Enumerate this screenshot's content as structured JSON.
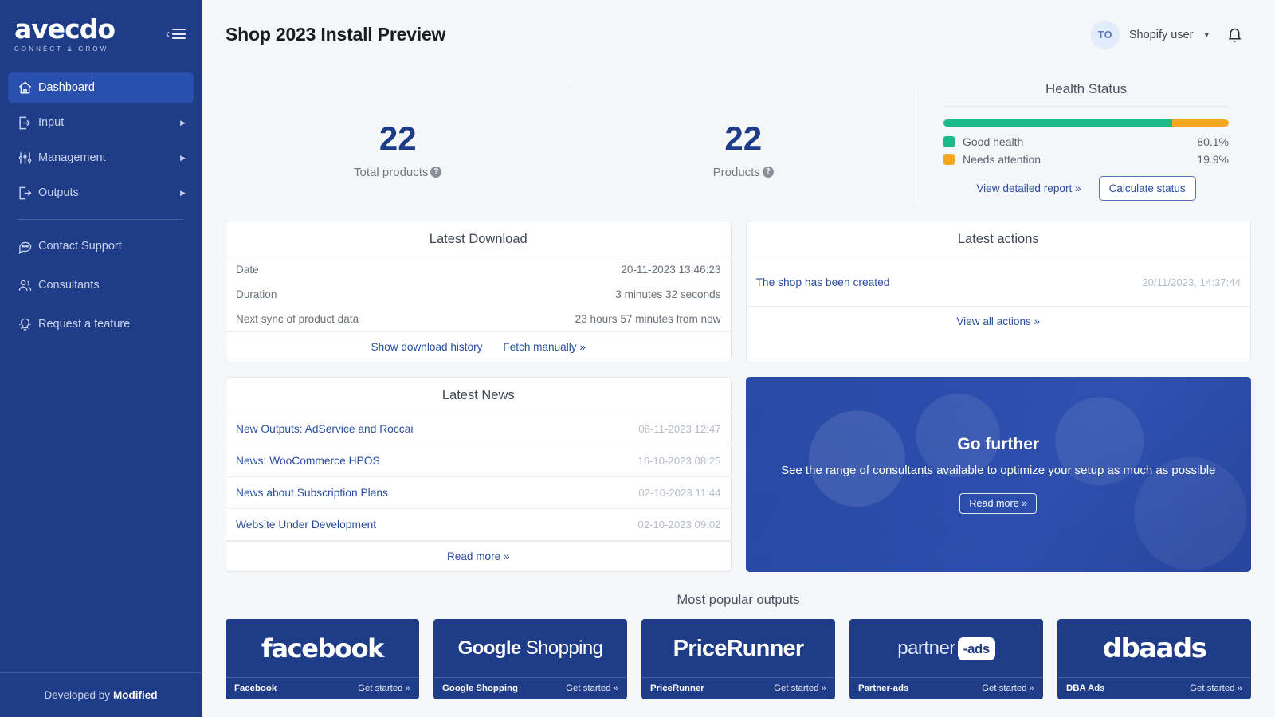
{
  "sidebar": {
    "logo_text": "avecdo",
    "logo_tagline": "CONNECT & GROW",
    "collapse_icon": "collapse-menu-icon",
    "nav": [
      {
        "label": "Dashboard",
        "icon": "home-icon",
        "active": true,
        "arrow": ""
      },
      {
        "label": "Input",
        "icon": "import-icon",
        "active": false,
        "arrow": "▶"
      },
      {
        "label": "Management",
        "icon": "sliders-icon",
        "active": false,
        "arrow": "▶"
      },
      {
        "label": "Outputs",
        "icon": "export-icon",
        "active": false,
        "arrow": "▶"
      }
    ],
    "secondary": [
      {
        "label": "Contact Support",
        "icon": "chat-bubble-icon"
      },
      {
        "label": "Consultants",
        "icon": "users-icon"
      },
      {
        "label": "Request a feature",
        "icon": "lightbulb-icon"
      }
    ],
    "footer_prefix": "Developed by",
    "footer_brand": "Modified"
  },
  "header": {
    "title": "Shop 2023 Install Preview",
    "avatar_initials": "TO",
    "user_name": "Shopify user",
    "caret_icon": "chevron-down-icon",
    "bell_icon": "notification-bell-icon"
  },
  "stats": [
    {
      "value": "22",
      "label": "Total products",
      "help": "?"
    },
    {
      "value": "22",
      "label": "Products",
      "help": "?"
    }
  ],
  "health": {
    "title": "Health Status",
    "good_label": "Good health",
    "good_pct": "80.1%",
    "good_color": "#1cb98a",
    "warn_label": "Needs attention",
    "warn_pct": "19.9%",
    "warn_color": "#f5a623",
    "report_link": "View detailed report »",
    "calculate_button": "Calculate status"
  },
  "latest_download": {
    "title": "Latest Download",
    "rows": [
      {
        "key": "Date",
        "value": "20-11-2023 13:46:23"
      },
      {
        "key": "Duration",
        "value": "3 minutes 32 seconds"
      },
      {
        "key": "Next sync of product data",
        "value": "23 hours 57 minutes from now"
      }
    ],
    "history_link": "Show download history",
    "fetch_link": "Fetch manually »"
  },
  "latest_actions": {
    "title": "Latest actions",
    "items": [
      {
        "label": "The shop has been created",
        "time": "20/11/2023, 14:37:44"
      }
    ],
    "view_all_link": "View all actions »"
  },
  "latest_news": {
    "title": "Latest News",
    "items": [
      {
        "label": "New Outputs: AdService and Roccai",
        "time": "08-11-2023 12:47"
      },
      {
        "label": "News: WooCommerce HPOS",
        "time": "16-10-2023 08:25"
      },
      {
        "label": "News about Subscription Plans",
        "time": "02-10-2023 11:44"
      },
      {
        "label": "Website Under Development",
        "time": "02-10-2023 09:02"
      }
    ],
    "read_more_link": "Read more »"
  },
  "promo": {
    "title": "Go further",
    "subtitle": "See the range of consultants available to optimize your setup as much as possible",
    "button": "Read more »"
  },
  "outputs": {
    "title": "Most popular outputs",
    "cta": "Get started »",
    "items": [
      {
        "name": "Facebook",
        "logo": "facebook"
      },
      {
        "name": "Google Shopping",
        "logo_a": "Google",
        "logo_b": "Shopping"
      },
      {
        "name": "PriceRunner",
        "logo": "PriceRunner"
      },
      {
        "name": "Partner-ads",
        "logo": "partner",
        "logo_tag": "-ads"
      },
      {
        "name": "DBA Ads",
        "logo": "dbaads"
      }
    ]
  }
}
